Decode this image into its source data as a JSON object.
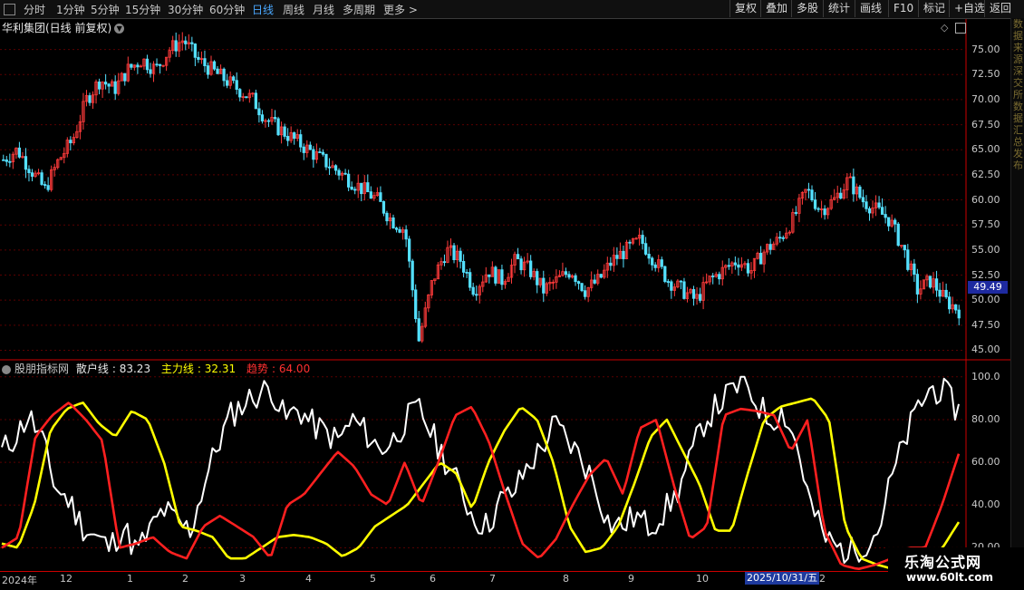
{
  "toolbar": {
    "periods": [
      "分时",
      "1分钟",
      "5分钟",
      "15分钟",
      "30分钟",
      "60分钟",
      "日线",
      "周线",
      "月线",
      "多周期",
      "更多"
    ],
    "active_period": "日线",
    "right_buttons": [
      "复权",
      "叠加",
      "多股",
      "统计",
      "画线",
      "F10",
      "标记",
      "+自选",
      "返回"
    ]
  },
  "stock": {
    "title": "华利集团(日线 前复权)",
    "last_price_tag": "49.49"
  },
  "price_axis": {
    "ticks": [
      "75.00",
      "72.50",
      "70.00",
      "67.50",
      "65.00",
      "62.50",
      "60.00",
      "57.50",
      "55.00",
      "52.50",
      "50.00",
      "47.50",
      "45.00"
    ],
    "range": [
      44.5,
      76.5
    ]
  },
  "indicator": {
    "source_name": "股朋指标网",
    "series": [
      {
        "name": "散户线",
        "value": "83.23",
        "color": "#ffffff"
      },
      {
        "name": "主力线",
        "value": "32.31",
        "color": "#ffff00"
      },
      {
        "name": "趋势",
        "value": "64.00",
        "color": "#ff2020"
      }
    ],
    "ticks": [
      "100.0",
      "80.00",
      "60.00",
      "40.00",
      "20.00"
    ],
    "range": [
      10,
      105
    ]
  },
  "x_axis": {
    "labels": [
      "2024年",
      "12",
      "1",
      "2",
      "3",
      "4",
      "5",
      "6",
      "7",
      "8",
      "9",
      "10",
      "2025/10/31/五",
      "2"
    ]
  },
  "right_strip_chars": "数据来源深交所数据汇总发布",
  "watermark": {
    "line1": "乐淘公式网",
    "line2": "www.60lt.com"
  },
  "chart_data": [
    {
      "type": "candlestick",
      "title": "华利集团(日线 前复权)",
      "ylim": [
        44.5,
        76.5
      ],
      "closes": [
        64,
        65,
        63,
        61,
        64,
        66,
        70,
        72,
        71,
        73,
        74,
        73,
        75,
        76,
        74,
        73,
        72,
        71,
        70,
        68,
        67,
        66,
        65,
        64,
        63,
        62,
        61,
        60,
        58,
        57,
        46,
        52,
        55,
        54,
        51,
        53,
        52,
        54,
        53,
        51,
        52,
        53,
        51,
        52,
        54,
        55,
        56,
        54,
        52,
        51,
        50,
        52,
        53,
        54,
        53,
        55,
        56,
        58,
        61,
        59,
        60,
        62,
        60,
        59,
        58,
        55,
        51,
        52,
        50,
        49
      ]
    },
    {
      "type": "line",
      "ylim": [
        10,
        105
      ],
      "series": [
        {
          "name": "散户线",
          "values": [
            65,
            72,
            82,
            70,
            48,
            42,
            30,
            25,
            20,
            30,
            18,
            28,
            38,
            32,
            28,
            50,
            68,
            82,
            88,
            92,
            95,
            80,
            85,
            78,
            74,
            70,
            80,
            74,
            66,
            70,
            80,
            85,
            72,
            60,
            48,
            34,
            30,
            42,
            46,
            58,
            66,
            78,
            70,
            62,
            50,
            32,
            30,
            35,
            30,
            36,
            44,
            60,
            78,
            86,
            92,
            98,
            88,
            80,
            84,
            68,
            40,
            25,
            20,
            18,
            22,
            28,
            52,
            70,
            86,
            95,
            92,
            84
          ]
        },
        {
          "name": "主力线",
          "values": [
            22,
            20,
            40,
            75,
            85,
            88,
            78,
            72,
            84,
            80,
            60,
            30,
            28,
            25,
            15,
            15,
            20,
            25,
            26,
            25,
            22,
            16,
            20,
            30,
            35,
            40,
            50,
            60,
            55,
            38,
            60,
            75,
            86,
            80,
            60,
            30,
            18,
            20,
            30,
            50,
            72,
            80,
            65,
            50,
            28,
            28,
            55,
            80,
            86,
            88,
            90,
            80,
            30,
            15,
            12,
            10,
            10,
            12,
            20,
            32
          ]
        },
        {
          "name": "趋势",
          "values": [
            20,
            25,
            72,
            82,
            88,
            80,
            70,
            20,
            22,
            25,
            18,
            15,
            30,
            35,
            30,
            25,
            15,
            40,
            45,
            55,
            65,
            58,
            45,
            40,
            60,
            40,
            60,
            82,
            86,
            70,
            45,
            22,
            15,
            24,
            40,
            54,
            62,
            45,
            76,
            80,
            50,
            24,
            30,
            82,
            85,
            84,
            82,
            65,
            80,
            28,
            12,
            10,
            12,
            15,
            20,
            20,
            40,
            64
          ]
        }
      ]
    }
  ]
}
